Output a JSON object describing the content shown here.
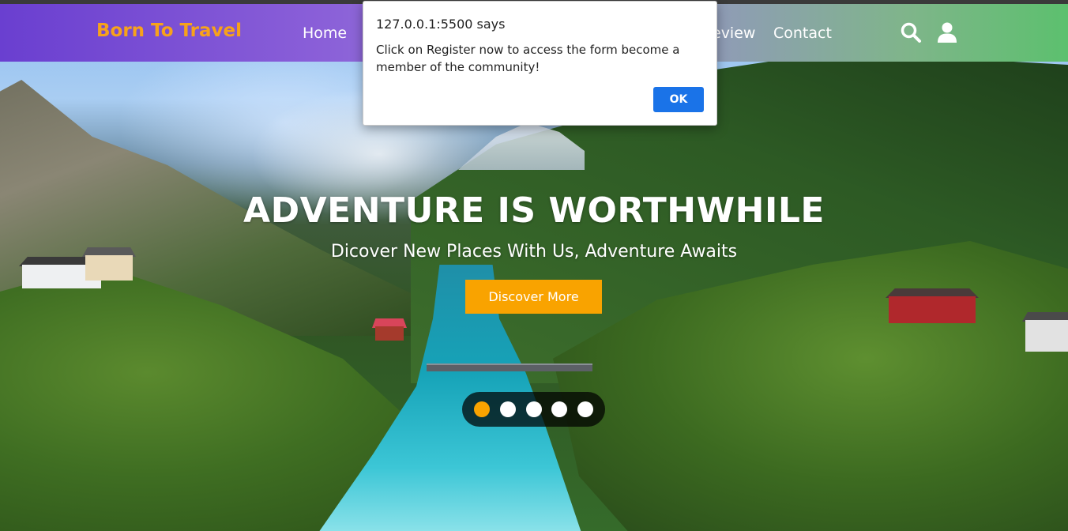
{
  "brand": {
    "name": "Born To Travel",
    "accent_color": "#f7a21b"
  },
  "nav": {
    "links": [
      {
        "label": "Home"
      },
      {
        "label": "eview"
      },
      {
        "label": "Contact"
      }
    ],
    "icons": [
      "search-icon",
      "user-icon"
    ]
  },
  "hero": {
    "title": "ADVENTURE IS WORTHWHILE",
    "subtitle": "Dicover New Places With Us, Adventure Awaits",
    "cta_label": "Discover More",
    "cta_color": "#f9a300",
    "slider": {
      "total": 5,
      "active_index": 0,
      "active_color": "#f9a300"
    }
  },
  "dialog": {
    "title": "127.0.0.1:5500 says",
    "message": "Click on Register now to access the form  become a member of the community!",
    "ok_label": "OK",
    "ok_color": "#1a73e8"
  }
}
